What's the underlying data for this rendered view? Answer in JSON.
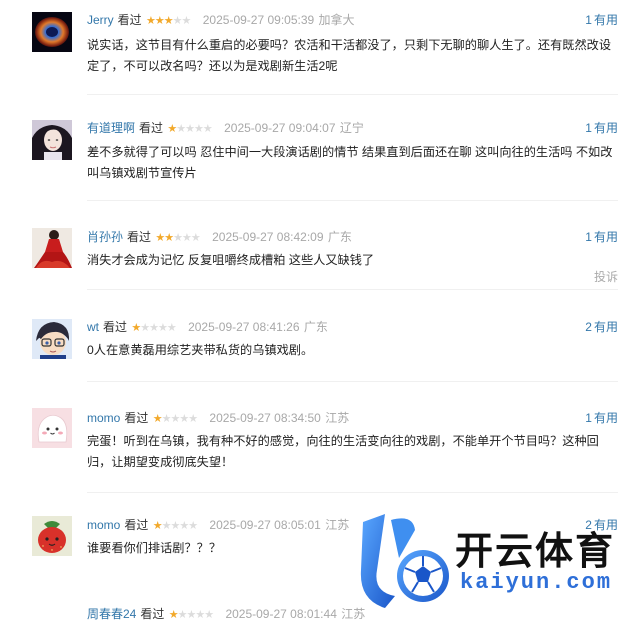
{
  "reviews": [
    {
      "user": "Jerry",
      "status": "看过",
      "rating": 3,
      "time": "2025-09-27 09:05:39",
      "location": "加拿大",
      "votes": "1",
      "votes_label": "有用",
      "content": "说实话，这节目有什么重启的必要吗？农活和干活都没了，只剩下无聊的聊人生了。还有既然改设定了，不可以改名吗？还以为是戏剧新生活2呢",
      "avatar": "galaxy-avatar",
      "report": ""
    },
    {
      "user": "有道理啊",
      "status": "看过",
      "rating": 1,
      "time": "2025-09-27 09:04:07",
      "location": "辽宁",
      "votes": "1",
      "votes_label": "有用",
      "content": "差不多就得了可以吗 忍住中间一大段演话剧的情节 结果直到后面还在聊 这叫向往的生活吗 不如改叫乌镇戏剧节宣传片",
      "avatar": "woman-portrait-avatar",
      "report": ""
    },
    {
      "user": "肖孙孙",
      "status": "看过",
      "rating": 2,
      "time": "2025-09-27 08:42:09",
      "location": "广东",
      "votes": "1",
      "votes_label": "有用",
      "content": "消失才会成为记忆 反复咀嚼终成槽粕 这些人又缺钱了",
      "avatar": "red-dress-avatar",
      "report": "投诉"
    },
    {
      "user": "wt",
      "status": "看过",
      "rating": 1,
      "time": "2025-09-27 08:41:26",
      "location": "广东",
      "votes": "2",
      "votes_label": "有用",
      "content": "0人在意黄磊用综艺夹带私货的乌镇戏剧。",
      "avatar": "anime-boy-avatar",
      "report": ""
    },
    {
      "user": "momo",
      "status": "看过",
      "rating": 1,
      "time": "2025-09-27 08:34:50",
      "location": "江苏",
      "votes": "1",
      "votes_label": "有用",
      "content": "完蛋！听到在乌镇，我有种不好的感觉，向往的生活变向往的戏剧，不能单开个节目吗？这种回归，让期望变成彻底失望！",
      "avatar": "cute-blob-avatar",
      "report": ""
    },
    {
      "user": "momo",
      "status": "看过",
      "rating": 1,
      "time": "2025-09-27 08:05:01",
      "location": "江苏",
      "votes": "2",
      "votes_label": "有用",
      "content": "谁要看你们排话剧？？？",
      "avatar": "strawberry-avatar",
      "report": ""
    },
    {
      "user": "周春春24",
      "status": "看过",
      "rating": 1,
      "time": "2025-09-27 08:01:44",
      "location": "江苏",
      "votes": "",
      "votes_label": "",
      "content": "",
      "avatar": "dark-avatar",
      "report": ""
    }
  ],
  "watermark": {
    "title": "开云体育",
    "subtitle": "kaiyun.com",
    "brand_color": "#2e6fd8"
  },
  "colors": {
    "username": "#3377aa",
    "star_on": "#f2a92b",
    "star_off": "#dcdcdc",
    "meta_gray": "#a8a8a8"
  }
}
